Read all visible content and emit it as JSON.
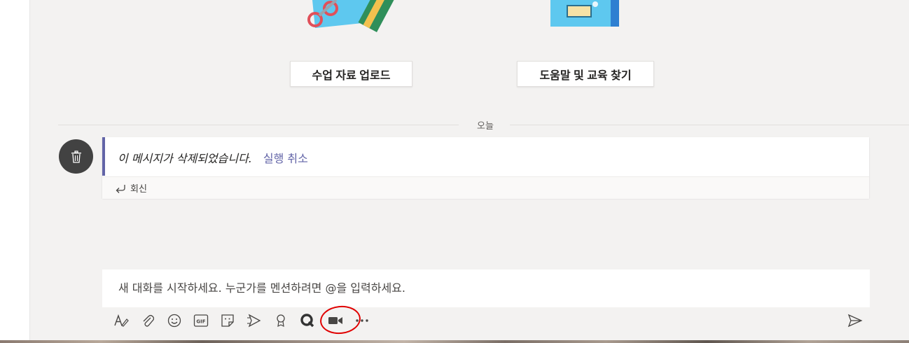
{
  "actions": {
    "upload_label": "수업 자료 업로드",
    "help_label": "도움말 및 교육 찾기"
  },
  "divider": {
    "label": "오늘"
  },
  "message": {
    "deleted_text": "이 메시지가 삭제되었습니다.",
    "undo_label": "실행 취소",
    "reply_label": "회신"
  },
  "compose": {
    "placeholder": "새 대화를 시작하세요. 누군가를 멘션하려면 @을 입력하세요."
  },
  "toolbar": {
    "icons": [
      "format-icon",
      "attach-icon",
      "emoji-icon",
      "gif-icon",
      "sticker-icon",
      "praise-icon",
      "approval-icon",
      "quiz-icon",
      "meet-now-icon",
      "more-options-icon"
    ],
    "gif_text": "GIF"
  },
  "colors": {
    "accent": "#6264a7",
    "annotation": "#e00000",
    "background": "#f3f2f1"
  }
}
